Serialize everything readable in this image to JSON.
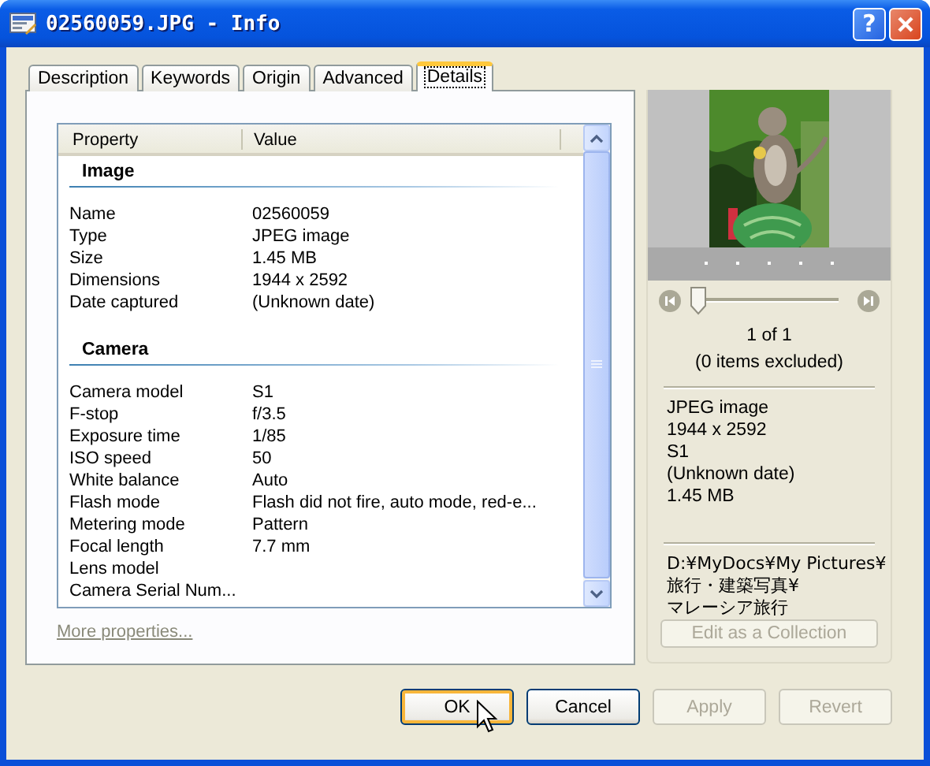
{
  "window": {
    "title": "02560059.JPG - Info",
    "help_button": "?"
  },
  "tabs": [
    {
      "label": "Description",
      "selected": false
    },
    {
      "label": "Keywords",
      "selected": false
    },
    {
      "label": "Origin",
      "selected": false
    },
    {
      "label": "Advanced",
      "selected": false
    },
    {
      "label": "Details",
      "selected": true
    }
  ],
  "properties": {
    "columns": [
      "Property",
      "Value"
    ],
    "sections": [
      {
        "title": "Image",
        "rows": [
          {
            "property": "Name",
            "value": "02560059"
          },
          {
            "property": "Type",
            "value": "JPEG image"
          },
          {
            "property": "Size",
            "value": "1.45 MB"
          },
          {
            "property": "Dimensions",
            "value": "1944 x 2592"
          },
          {
            "property": "Date captured",
            "value": "(Unknown date)"
          }
        ]
      },
      {
        "title": "Camera",
        "rows": [
          {
            "property": "Camera model",
            "value": "S1"
          },
          {
            "property": "F-stop",
            "value": "f/3.5"
          },
          {
            "property": "Exposure time",
            "value": "1/85"
          },
          {
            "property": "ISO speed",
            "value": "50"
          },
          {
            "property": "White balance",
            "value": "Auto"
          },
          {
            "property": "Flash mode",
            "value": "Flash did not fire, auto mode, red-e..."
          },
          {
            "property": "Metering mode",
            "value": "Pattern"
          },
          {
            "property": "Focal length",
            "value": "7.7 mm"
          },
          {
            "property": "Lens model"
          },
          {
            "property": "Camera Serial Num..."
          }
        ]
      }
    ],
    "more_link": "More properties..."
  },
  "preview": {
    "slider": {
      "level": 0
    },
    "position": "1 of 1",
    "excluded": "(0 items excluded)",
    "summary": [
      "JPEG image",
      "1944 x 2592",
      "S1",
      "(Unknown date)",
      "1.45 MB"
    ],
    "path": [
      "D:¥MyDocs¥My Pictures¥",
      "旅行・建築写真¥",
      "マレーシア旅行"
    ],
    "edit_button": {
      "label": "Edit as a Collection",
      "disabled": true
    }
  },
  "buttons": [
    {
      "label": "OK",
      "disabled": false,
      "focused": true
    },
    {
      "label": "Cancel",
      "disabled": false,
      "focused": false
    },
    {
      "label": "Apply",
      "disabled": true,
      "focused": false
    },
    {
      "label": "Revert",
      "disabled": true,
      "focused": false
    }
  ]
}
